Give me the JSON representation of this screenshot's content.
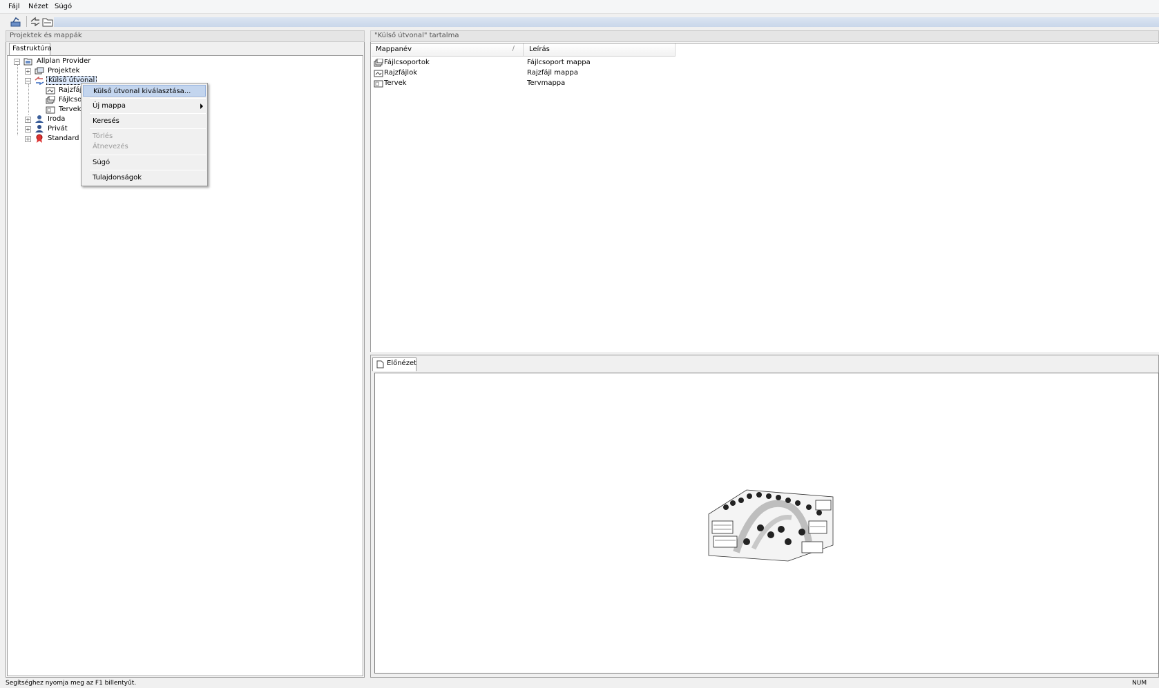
{
  "menu": [
    {
      "label": "Fájl"
    },
    {
      "label": "Nézet"
    },
    {
      "label": "Súgó"
    }
  ],
  "left_pane": {
    "title": "Projektek és mappák",
    "tab": "Fastruktúra",
    "tree": [
      {
        "label": "Allplan Provider",
        "icon": "folder-open-icon"
      },
      {
        "label": "Projektek",
        "icon": "projects-icon"
      },
      {
        "label": "Külső útvonal",
        "icon": "external-path-icon"
      },
      {
        "label": "Rajzfáj",
        "icon": "drawing-file-icon"
      },
      {
        "label": "Fájlcso",
        "icon": "filegroup-icon"
      },
      {
        "label": "Tervek",
        "icon": "plan-icon"
      },
      {
        "label": "Iroda",
        "icon": "office-icon"
      },
      {
        "label": "Privát",
        "icon": "user-icon"
      },
      {
        "label": "Standard",
        "icon": "standard-icon"
      }
    ]
  },
  "context_menu": {
    "items": [
      {
        "label": "Külső útvonal kiválasztása...",
        "state": "selected"
      },
      {
        "label": "Új mappa",
        "state": "submenu"
      },
      {
        "label": "Keresés",
        "state": "normal"
      },
      {
        "label": "Törlés",
        "state": "disabled"
      },
      {
        "label": "Átnevezés",
        "state": "disabled"
      },
      {
        "label": "Súgó",
        "state": "normal"
      },
      {
        "label": "Tulajdonságok",
        "state": "normal"
      }
    ]
  },
  "right_pane": {
    "title": "\"Külső útvonal\" tartalma",
    "columns": [
      "Mappanév",
      "Leírás"
    ],
    "rows": [
      {
        "name": "Fájlcsoportok",
        "description": "Fájlcsoport mappa"
      },
      {
        "name": "Rajzfájlok",
        "description": "Rajzfájl mappa"
      },
      {
        "name": "Tervek",
        "description": "Tervmappa"
      }
    ]
  },
  "preview": {
    "tab": "Előnézet"
  },
  "status": {
    "hint": "Segítséghez nyomja meg az F1 billentyűt.",
    "num": "NUM"
  },
  "colors": {
    "selection": "#c3d5ee",
    "tree_selection": "#3399ff",
    "toolbar_band": "#dbe5f2"
  }
}
